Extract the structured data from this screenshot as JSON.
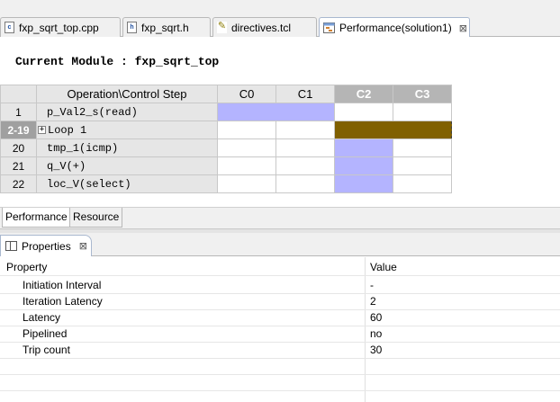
{
  "editor_tabs": [
    {
      "label": "fxp_sqrt_top.cpp",
      "icon": "cpp-file-icon",
      "icon_glyph": "c"
    },
    {
      "label": "fxp_sqrt.h",
      "icon": "header-file-icon",
      "icon_glyph": "h"
    },
    {
      "label": "directives.tcl",
      "icon": "tcl-file-icon",
      "icon_glyph": "✎"
    },
    {
      "label": "Performance(solution1)",
      "icon": "performance-icon",
      "close": "⊠"
    }
  ],
  "module": {
    "title": "Current Module : fxp_sqrt_top"
  },
  "schedule": {
    "header": {
      "op": "Operation\\Control Step",
      "steps": [
        "C0",
        "C1",
        "C2",
        "C3"
      ]
    },
    "rows": [
      {
        "id": "1",
        "op": "p_Val2_s(read)"
      },
      {
        "id": "2-19",
        "op": "Loop 1",
        "expander": "+"
      },
      {
        "id": "20",
        "op": "tmp_1(icmp)"
      },
      {
        "id": "21",
        "op": "q_V(+)"
      },
      {
        "id": "22",
        "op": "loc_V(select)"
      }
    ],
    "colors": {
      "op_fill": "#b4b4ff",
      "loop_fill": "#806000"
    }
  },
  "sub_tabs": [
    "Performance",
    "Resource"
  ],
  "properties_view": {
    "tab_label": "Properties",
    "close": "⊠",
    "header": {
      "property": "Property",
      "value": "Value"
    },
    "rows": [
      {
        "property": "Initiation Interval",
        "value": "-"
      },
      {
        "property": "Iteration Latency",
        "value": "2"
      },
      {
        "property": "Latency",
        "value": "60"
      },
      {
        "property": "Pipelined",
        "value": "no"
      },
      {
        "property": "Trip count",
        "value": "30"
      }
    ]
  }
}
